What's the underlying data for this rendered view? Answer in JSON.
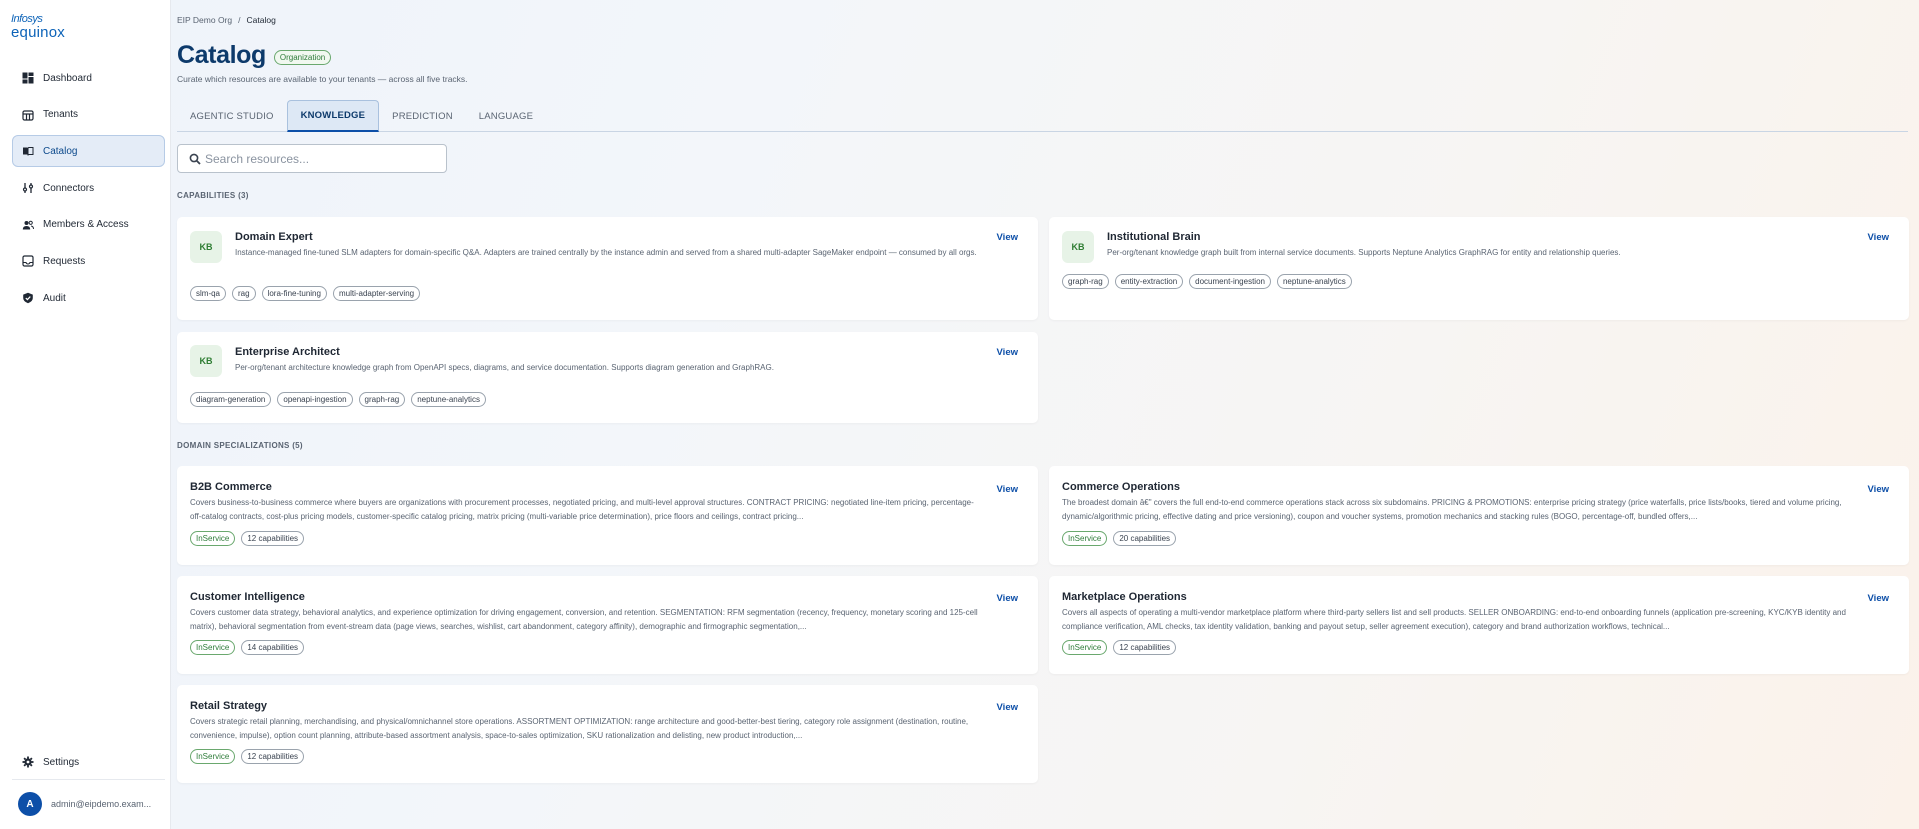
{
  "brand": {
    "line1": "Infosys",
    "line2": "equinox"
  },
  "sidebar": {
    "items": [
      {
        "label": "Dashboard",
        "icon": "dashboard-icon"
      },
      {
        "label": "Tenants",
        "icon": "tenants-icon"
      },
      {
        "label": "Catalog",
        "icon": "catalog-icon",
        "active": true
      },
      {
        "label": "Connectors",
        "icon": "connectors-icon"
      },
      {
        "label": "Members & Access",
        "icon": "members-icon"
      },
      {
        "label": "Requests",
        "icon": "requests-icon"
      },
      {
        "label": "Audit",
        "icon": "audit-icon"
      }
    ],
    "settings_label": "Settings",
    "user": {
      "initial": "A",
      "email": "admin@eipdemo.exam..."
    }
  },
  "breadcrumb": {
    "org": "EIP Demo Org",
    "sep": "/",
    "current": "Catalog"
  },
  "page": {
    "title": "Catalog",
    "badge": "Organization",
    "subtitle": "Curate which resources are available to your tenants — across all five tracks."
  },
  "tabs": [
    {
      "label": "AGENTIC STUDIO"
    },
    {
      "label": "KNOWLEDGE",
      "active": true
    },
    {
      "label": "PREDICTION"
    },
    {
      "label": "LANGUAGE"
    }
  ],
  "search": {
    "placeholder": "Search resources...",
    "value": ""
  },
  "capabilities": {
    "heading": "CAPABILITIES (3)",
    "items": [
      {
        "badge": "KB",
        "title": "Domain Expert",
        "desc": "Instance-managed fine-tuned SLM adapters for domain-specific Q&A. Adapters are trained centrally by the instance admin and served from a shared multi-adapter SageMaker endpoint — consumed by all orgs.",
        "tags": [
          "slm-qa",
          "rag",
          "lora-fine-tuning",
          "multi-adapter-serving"
        ],
        "action": "View"
      },
      {
        "badge": "KB",
        "title": "Institutional Brain",
        "desc": "Per-org/tenant knowledge graph built from internal service documents. Supports Neptune Analytics GraphRAG for entity and relationship queries.",
        "tags": [
          "graph-rag",
          "entity-extraction",
          "document-ingestion",
          "neptune-analytics"
        ],
        "action": "View"
      },
      {
        "badge": "KB",
        "title": "Enterprise Architect",
        "desc": "Per-org/tenant architecture knowledge graph from OpenAPI specs, diagrams, and service documentation. Supports diagram generation and GraphRAG.",
        "tags": [
          "diagram-generation",
          "openapi-ingestion",
          "graph-rag",
          "neptune-analytics"
        ],
        "action": "View"
      }
    ]
  },
  "domains": {
    "heading": "DOMAIN SPECIALIZATIONS (5)",
    "items": [
      {
        "title": "B2B Commerce",
        "desc": "Covers business-to-business commerce where buyers are organizations with procurement processes, negotiated pricing, and multi-level approval structures. CONTRACT PRICING: negotiated line-item pricing, percentage-off-catalog contracts, cost-plus pricing models, customer-specific catalog pricing, matrix pricing (multi-variable price determination), price floors and ceilings, contract pricing...",
        "status": "InService",
        "count": "12 capabilities",
        "action": "View"
      },
      {
        "title": "Commerce Operations",
        "desc": "The broadest domain â€\" covers the full end-to-end commerce operations stack across six subdomains. PRICING & PROMOTIONS: enterprise pricing strategy (price waterfalls, price lists/books, tiered and volume pricing, dynamic/algorithmic pricing, effective dating and price versioning), coupon and voucher systems, promotion mechanics and stacking rules (BOGO, percentage-off, bundled offers,...",
        "status": "InService",
        "count": "20 capabilities",
        "action": "View"
      },
      {
        "title": "Customer Intelligence",
        "desc": "Covers customer data strategy, behavioral analytics, and experience optimization for driving engagement, conversion, and retention. SEGMENTATION: RFM segmentation (recency, frequency, monetary scoring and 125-cell matrix), behavioral segmentation from event-stream data (page views, searches, wishlist, cart abandonment, category affinity), demographic and firmographic segmentation,...",
        "status": "InService",
        "count": "14 capabilities",
        "action": "View"
      },
      {
        "title": "Marketplace Operations",
        "desc": "Covers all aspects of operating a multi-vendor marketplace platform where third-party sellers list and sell products. SELLER ONBOARDING: end-to-end onboarding funnels (application pre-screening, KYC/KYB identity and compliance verification, AML checks, tax identity validation, banking and payout setup, seller agreement execution), category and brand authorization workflows, technical...",
        "status": "InService",
        "count": "12 capabilities",
        "action": "View"
      },
      {
        "title": "Retail Strategy",
        "desc": "Covers strategic retail planning, merchandising, and physical/omnichannel store operations. ASSORTMENT OPTIMIZATION: range architecture and good-better-best tiering, category role assignment (destination, routine, convenience, impulse), option count planning, attribute-based assortment analysis, space-to-sales optimization, SKU rationalization and delisting, new product introduction,...",
        "status": "InService",
        "count": "12 capabilities",
        "action": "View"
      }
    ]
  },
  "colors": {
    "accent": "#0d4fa8",
    "title": "#0d3a6b",
    "success": "#2f7d3a"
  }
}
